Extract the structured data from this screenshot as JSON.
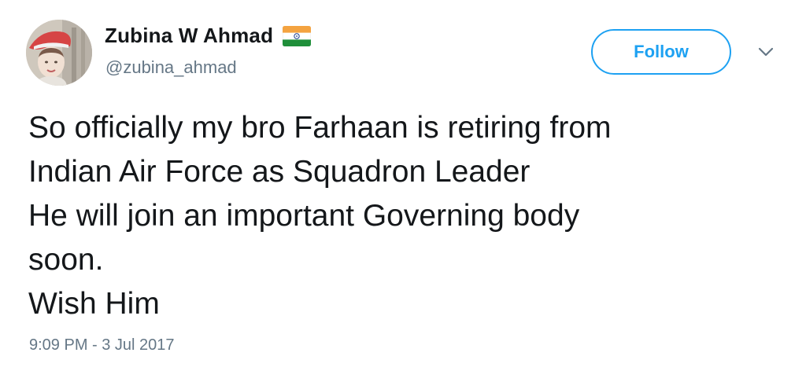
{
  "author": {
    "name": "Zubina W Ahmad",
    "handle": "@zubina_ahmad",
    "name_badge": "india-flag-icon"
  },
  "follow_button": {
    "label": "Follow",
    "color": "#1da1f2"
  },
  "menu": {
    "icon": "chevron-down-icon"
  },
  "tweet": {
    "lines": [
      "So officially my bro Farhaan is retiring from",
      "Indian Air Force as Squadron Leader",
      "He will join an important Governing body",
      "soon.",
      "Wish Him"
    ],
    "timestamp": "9:09 PM - 3 Jul 2017"
  },
  "colors": {
    "text": "#14171a",
    "secondary": "#657786",
    "accent": "#1da1f2"
  }
}
